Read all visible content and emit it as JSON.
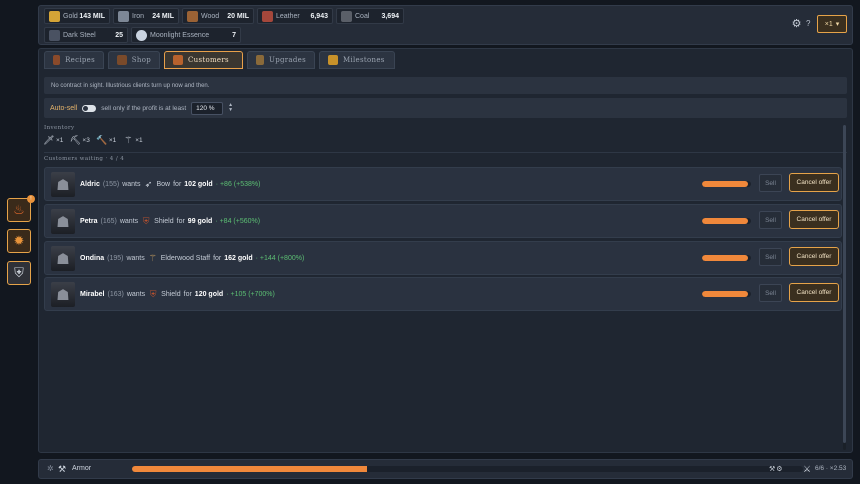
{
  "resources": [
    {
      "label": "Gold",
      "value": "143 MIL",
      "color": "#d4a437"
    },
    {
      "label": "Iron",
      "value": "24 MIL",
      "color": "#7d8796"
    },
    {
      "label": "Wood",
      "value": "20 MIL",
      "color": "#9a6235"
    },
    {
      "label": "Leather",
      "value": "6,943",
      "color": "#a4473b"
    },
    {
      "label": "Coal",
      "value": "3,694",
      "color": "#5a5f68"
    },
    {
      "label": "Dark Steel",
      "value": "25",
      "color": "#4a5262"
    },
    {
      "label": "Moonlight Essence",
      "value": "7",
      "color": "#c9d3e0"
    }
  ],
  "header": {
    "help": "?",
    "multiplier": "×1",
    "mult_arrow": "▾"
  },
  "tabs": [
    {
      "label": "Recipes"
    },
    {
      "label": "Shop"
    },
    {
      "label": "Customers"
    },
    {
      "label": "Upgrades"
    },
    {
      "label": "Milestones"
    }
  ],
  "notice": "No contract in sight. Illustrious clients turn up now and then.",
  "autosell": {
    "label": "Auto-sell",
    "text": "sell only if the profit is at least",
    "value": "120 %",
    "spin_up": "▲",
    "spin_down": "▼"
  },
  "inventory": {
    "title": "Inventory",
    "items": [
      {
        "icon": "sword-icon",
        "glyph": "🗡",
        "count": "×1"
      },
      {
        "icon": "pickaxe-icon",
        "glyph": "⛏",
        "count": "×3"
      },
      {
        "icon": "hammer-icon",
        "glyph": "🔨",
        "count": "×1"
      },
      {
        "icon": "staff-icon",
        "glyph": "⚚",
        "count": "×1"
      }
    ]
  },
  "customers_title": "Customers waiting · 4 / 4",
  "customers": [
    {
      "name": "Aldric",
      "level": "(155)",
      "wants": "wants",
      "item": "Bow",
      "for_text": "for",
      "gold": "102 gold",
      "profit": "· +86 (+538%)",
      "item_glyph": "➶",
      "patience": 0.93
    },
    {
      "name": "Petra",
      "level": "(165)",
      "wants": "wants",
      "item": "Shield",
      "for_text": "for",
      "gold": "99 gold",
      "profit": "· +84 (+560%)",
      "item_glyph": "⛨",
      "patience": 0.93
    },
    {
      "name": "Ondina",
      "level": "(195)",
      "wants": "wants",
      "item": "Elderwood Staff",
      "for_text": "for",
      "gold": "162 gold",
      "profit": "· +144 (+800%)",
      "item_glyph": "⚚",
      "patience": 0.93
    },
    {
      "name": "Mirabel",
      "level": "(163)",
      "wants": "wants",
      "item": "Shield",
      "for_text": "for",
      "gold": "120 gold",
      "profit": "· +105 (+700%)",
      "item_glyph": "⛨",
      "patience": 0.93
    }
  ],
  "buttons": {
    "sell": "Sell",
    "cancel": "Cancel offer"
  },
  "sidebar": {
    "badge": "!"
  },
  "craft": {
    "item": "Armor",
    "progress": 0.35,
    "tools": "⚒⚙",
    "count": "6/6 · ×2.53"
  }
}
